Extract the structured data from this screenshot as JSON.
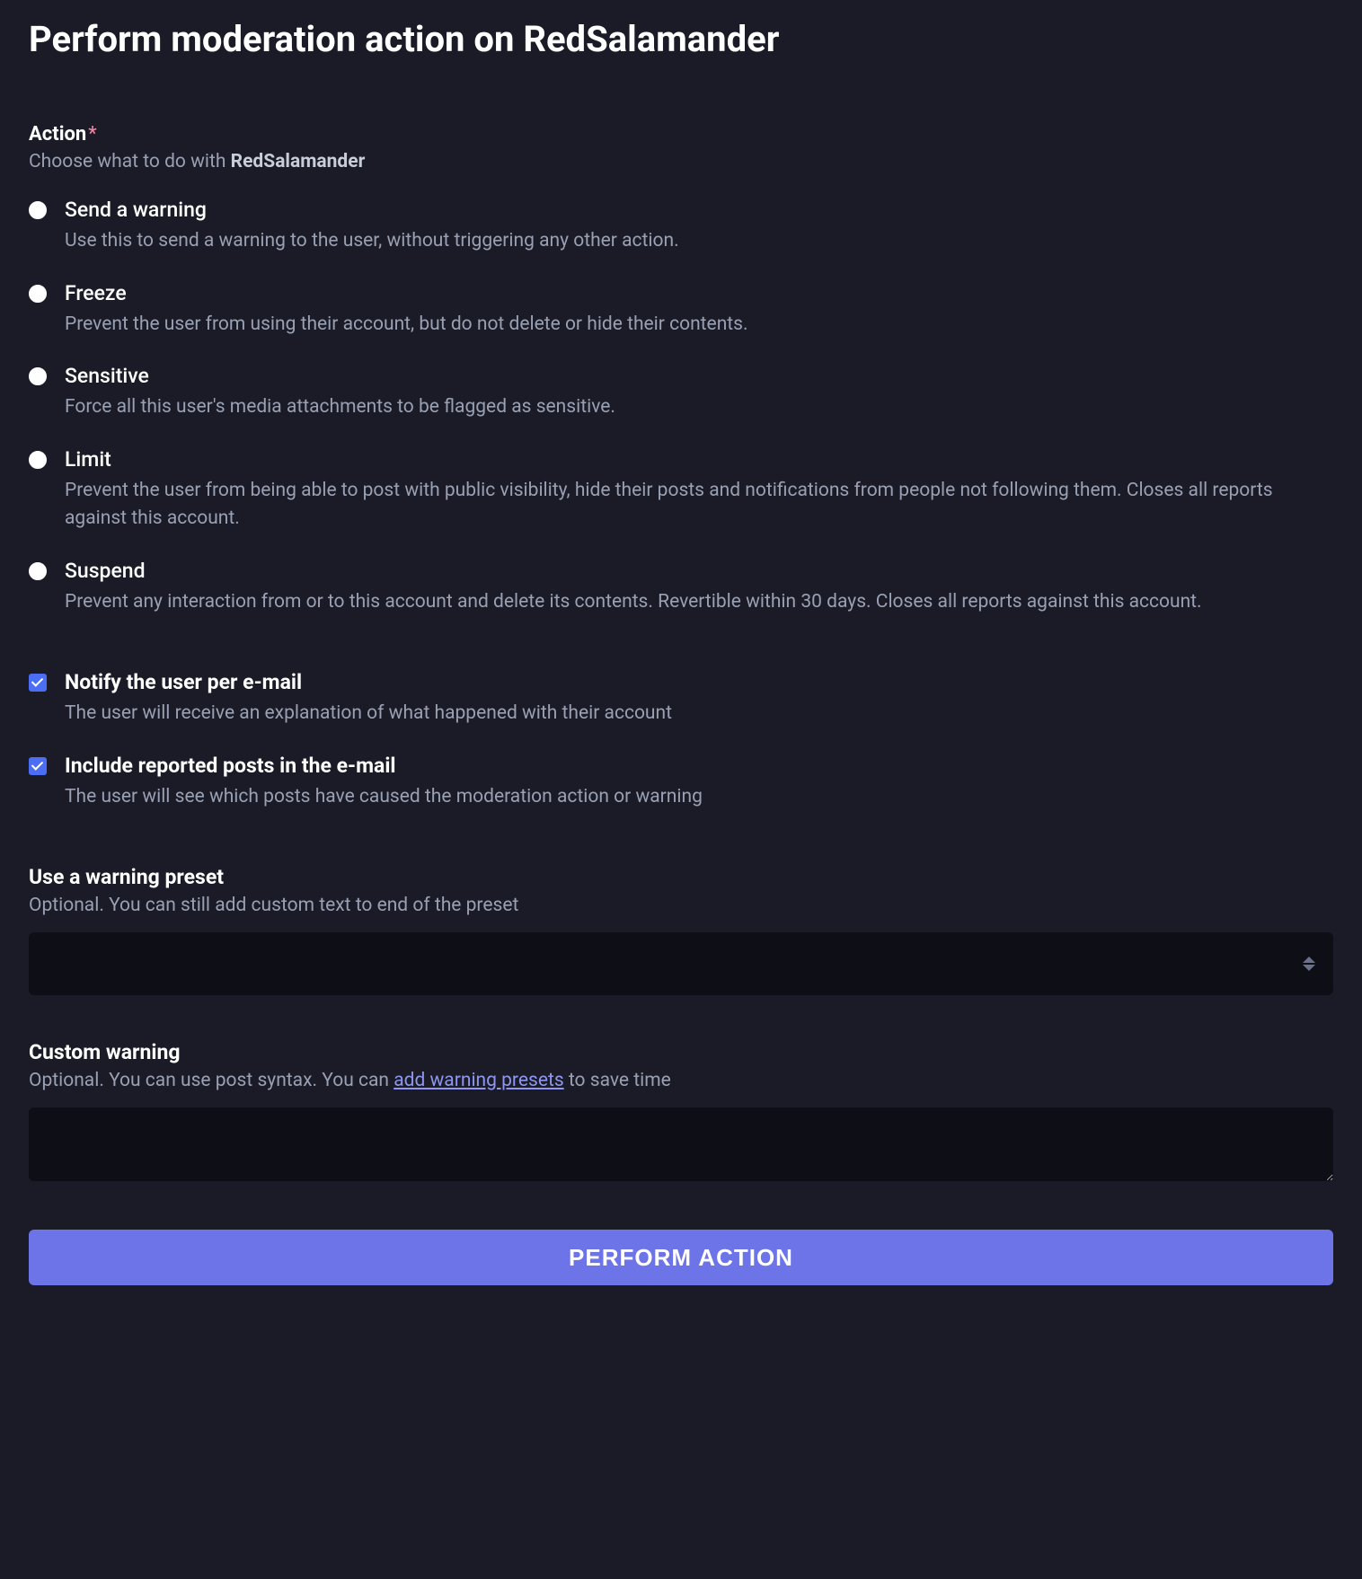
{
  "page_title": "Perform moderation action on RedSalamander",
  "action_section": {
    "label": "Action",
    "required": true,
    "hint_prefix": "Choose what to do with ",
    "hint_username": "RedSalamander",
    "options": [
      {
        "title": "Send a warning",
        "description": "Use this to send a warning to the user, without triggering any other action."
      },
      {
        "title": "Freeze",
        "description": "Prevent the user from using their account, but do not delete or hide their contents."
      },
      {
        "title": "Sensitive",
        "description": "Force all this user's media attachments to be flagged as sensitive."
      },
      {
        "title": "Limit",
        "description": "Prevent the user from being able to post with public visibility, hide their posts and notifications from people not following them. Closes all reports against this account."
      },
      {
        "title": "Suspend",
        "description": "Prevent any interaction from or to this account and delete its contents. Revertible within 30 days. Closes all reports against this account."
      }
    ]
  },
  "checkboxes": [
    {
      "title": "Notify the user per e-mail",
      "description": "The user will receive an explanation of what happened with their account",
      "checked": true
    },
    {
      "title": "Include reported posts in the e-mail",
      "description": "The user will see which posts have caused the moderation action or warning",
      "checked": true
    }
  ],
  "preset_section": {
    "label": "Use a warning preset",
    "hint": "Optional. You can still add custom text to end of the preset",
    "value": ""
  },
  "custom_section": {
    "label": "Custom warning",
    "hint_before": "Optional. You can use post syntax. You can ",
    "hint_link": "add warning presets",
    "hint_after": " to save time",
    "value": ""
  },
  "submit_label": "Perform Action"
}
